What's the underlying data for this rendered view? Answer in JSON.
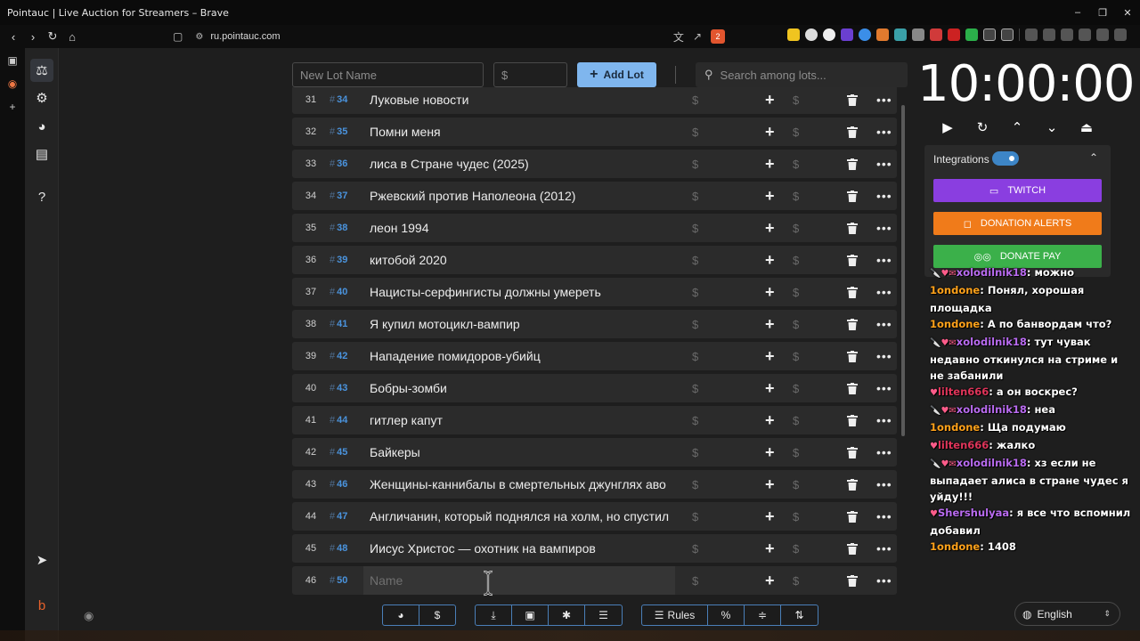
{
  "window": {
    "title": "Pointauc | Live Auction for Streamers – Brave",
    "controls": [
      "–",
      "❐",
      "✕"
    ]
  },
  "browser": {
    "url": "ru.pointauc.com",
    "shield_count": "2"
  },
  "toolbar": {
    "lot_name_placeholder": "New Lot Name",
    "amount_placeholder": "$",
    "add_lot_label": "Add Lot",
    "search_placeholder": "Search among lots..."
  },
  "lots": [
    {
      "num": "31",
      "id": "34",
      "name": "Луковые новости"
    },
    {
      "num": "32",
      "id": "35",
      "name": "Помни меня"
    },
    {
      "num": "33",
      "id": "36",
      "name": "лиса в Стране чудес (2025)"
    },
    {
      "num": "34",
      "id": "37",
      "name": " Ржевский против Наполеона (2012)"
    },
    {
      "num": "35",
      "id": "38",
      "name": "леон 1994"
    },
    {
      "num": "36",
      "id": "39",
      "name": "китобой 2020"
    },
    {
      "num": "37",
      "id": "40",
      "name": " Нацисты-серфингисты должны умереть"
    },
    {
      "num": "38",
      "id": "41",
      "name": "Я купил мотоцикл-вампир"
    },
    {
      "num": "39",
      "id": "42",
      "name": "Нападение помидоров-убийц"
    },
    {
      "num": "40",
      "id": "43",
      "name": "Бобры-зомби"
    },
    {
      "num": "41",
      "id": "44",
      "name": "гитлер капут"
    },
    {
      "num": "42",
      "id": "45",
      "name": "Байкеры"
    },
    {
      "num": "43",
      "id": "46",
      "name": "Женщины-каннибалы в смертельных джунглях аво"
    },
    {
      "num": "44",
      "id": "47",
      "name": "Англичанин, который поднялся на холм, но спустил"
    },
    {
      "num": "45",
      "id": "48",
      "name": " Иисус Христос — охотник на вампиров"
    }
  ],
  "new_row": {
    "num": "46",
    "id": "50",
    "placeholder": "Name"
  },
  "row_symbols": {
    "hash": "#",
    "dollar": "$"
  },
  "bottom_toolbar": {
    "rules_label": "Rules",
    "dollar": "$",
    "percent": "%"
  },
  "timer": {
    "value": "10:00:00"
  },
  "integrations": {
    "label": "Integrations",
    "enabled": true,
    "twitch": "TWITCH",
    "donation_alerts": "DONATION ALERTS",
    "donate_pay": "DONATE PAY",
    "colors": {
      "twitch": "#8a3ee0",
      "donation_alerts": "#f07b1a",
      "donate_pay": "#3bb04a"
    }
  },
  "chat": [
    {
      "user": "xolodilnik18",
      "cls": "u-purple",
      "badges": "🔪♥✉",
      "text": "можно"
    },
    {
      "user": "1ondone",
      "cls": "u-orange",
      "badges": "",
      "text": "Понял, хорошая площадка"
    },
    {
      "user": "1ondone",
      "cls": "u-orange",
      "badges": "",
      "text": "А по банвордам что?"
    },
    {
      "user": "xolodilnik18",
      "cls": "u-purple",
      "badges": "🔪♥✉",
      "text": "тут чувак недавно откинулся на стриме и не забанили"
    },
    {
      "user": "lilten666",
      "cls": "u-red",
      "badges": "♥",
      "text": "а он воскрес?"
    },
    {
      "user": "xolodilnik18",
      "cls": "u-purple",
      "badges": "🔪♥✉",
      "text": "неа"
    },
    {
      "user": "1ondone",
      "cls": "u-orange",
      "badges": "",
      "text": "Ща подумаю"
    },
    {
      "user": "lilten666",
      "cls": "u-red",
      "badges": "♥",
      "text": "жалко"
    },
    {
      "user": "xolodilnik18",
      "cls": "u-purple",
      "badges": "🔪♥✉",
      "text": "хз если не выпадает алиса в стране чудес я уйду!!!"
    },
    {
      "user": "Shershulyaa",
      "cls": "u-purple",
      "badges": "♥",
      "text": "я все что вспомнил добавил"
    },
    {
      "user": "1ondone",
      "cls": "u-orange",
      "badges": "",
      "text": "1408"
    }
  ],
  "language": {
    "selected": "English"
  }
}
